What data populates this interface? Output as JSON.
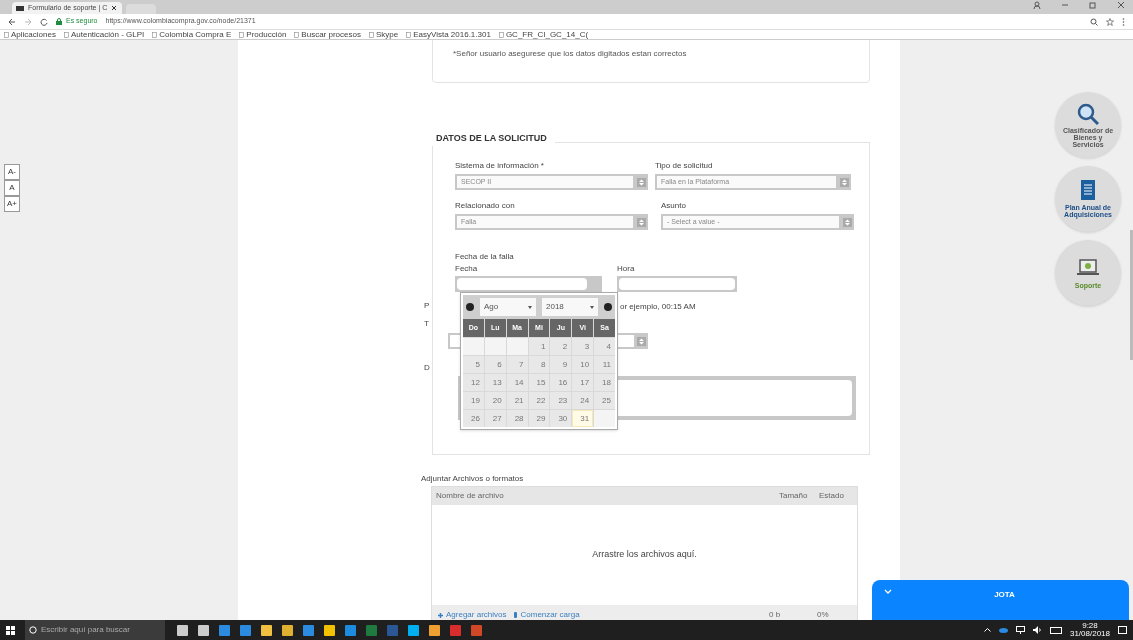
{
  "browser": {
    "tab_title": "Formulario de soporte | C",
    "url_secure": "Es seguro",
    "url": "https://www.colombiacompra.gov.co/node/21371",
    "bookmarks": [
      "Aplicaciones",
      "Autenticación - GLPI",
      "Colombia Compra E",
      "Producción",
      "Buscar procesos",
      "Skype",
      "EasyVista 2016.1.301",
      "GC_FR_CI_GC_14_C("
    ]
  },
  "font_size_buttons": [
    "A-",
    "A",
    "A+"
  ],
  "notice": "*Señor usuario asegurese que los datos digitados estan correctos",
  "section_title": "DATOS DE LA SOLICITUD",
  "selects": [
    {
      "label": "Sistema de información *",
      "value": "SECOP II"
    },
    {
      "label": "Tipo de solicitud",
      "value": "Falla en la Plataforma"
    },
    {
      "label": "Relacionado con",
      "value": "Falla"
    },
    {
      "label": "Asunto",
      "value": "- Select a value -"
    }
  ],
  "date_group": {
    "title": "Fecha de la falla",
    "date_label": "Fecha",
    "time_label": "Hora"
  },
  "hidden_fragments": {
    "hint_start": "P",
    "hint_end": "or ejemplo, 00:15 AM",
    "label_2": "T",
    "label_3": "D"
  },
  "datepicker": {
    "month": "Ago",
    "year": "2018",
    "weekdays": [
      "Do",
      "Lu",
      "Ma",
      "Mi",
      "Ju",
      "Vi",
      "Sa"
    ],
    "days": [
      {
        "kind": "blank"
      },
      {
        "kind": "blank"
      },
      {
        "kind": "blank"
      },
      {
        "kind": "day",
        "label": "1",
        "today": false
      },
      {
        "kind": "day",
        "label": "2",
        "today": false
      },
      {
        "kind": "day",
        "label": "3",
        "today": false
      },
      {
        "kind": "day",
        "label": "4",
        "today": false
      },
      {
        "kind": "day",
        "label": "5",
        "today": false
      },
      {
        "kind": "day",
        "label": "6",
        "today": false
      },
      {
        "kind": "day",
        "label": "7",
        "today": false
      },
      {
        "kind": "day",
        "label": "8",
        "today": false
      },
      {
        "kind": "day",
        "label": "9",
        "today": false
      },
      {
        "kind": "day",
        "label": "10",
        "today": false
      },
      {
        "kind": "day",
        "label": "11",
        "today": false
      },
      {
        "kind": "day",
        "label": "12",
        "today": false
      },
      {
        "kind": "day",
        "label": "13",
        "today": false
      },
      {
        "kind": "day",
        "label": "14",
        "today": false
      },
      {
        "kind": "day",
        "label": "15",
        "today": false
      },
      {
        "kind": "day",
        "label": "16",
        "today": false
      },
      {
        "kind": "day",
        "label": "17",
        "today": false
      },
      {
        "kind": "day",
        "label": "18",
        "today": false
      },
      {
        "kind": "day",
        "label": "19",
        "today": false
      },
      {
        "kind": "day",
        "label": "20",
        "today": false
      },
      {
        "kind": "day",
        "label": "21",
        "today": false
      },
      {
        "kind": "day",
        "label": "22",
        "today": false
      },
      {
        "kind": "day",
        "label": "23",
        "today": false
      },
      {
        "kind": "day",
        "label": "24",
        "today": false
      },
      {
        "kind": "day",
        "label": "25",
        "today": false
      },
      {
        "kind": "day",
        "label": "26",
        "today": false
      },
      {
        "kind": "day",
        "label": "27",
        "today": false
      },
      {
        "kind": "day",
        "label": "28",
        "today": false
      },
      {
        "kind": "day",
        "label": "29",
        "today": false
      },
      {
        "kind": "day",
        "label": "30",
        "today": false
      },
      {
        "kind": "day",
        "label": "31",
        "today": true
      },
      {
        "kind": "blank"
      }
    ]
  },
  "attachments": {
    "title": "Adjuntar Archivos o formatos",
    "columns": [
      "Nombre de archivo",
      "Tamaño",
      "Estado"
    ],
    "drop_text": "Arrastre los archivos aquí.",
    "add": "Agregar archivos",
    "start": "Comenzar carga",
    "size": "0 b",
    "status": "0%"
  },
  "side_buttons": [
    {
      "kind": "search",
      "label": "Clasificador de Bienes y Servicios"
    },
    {
      "kind": "document",
      "label": "Plan Anual de Adquisiciones"
    },
    {
      "kind": "laptop",
      "label": "Soporte"
    }
  ],
  "chat": {
    "title": "JOTA"
  },
  "taskbar": {
    "search_placeholder": "Escribir aquí para buscar",
    "time": "9:28",
    "date": "31/08/2018"
  }
}
